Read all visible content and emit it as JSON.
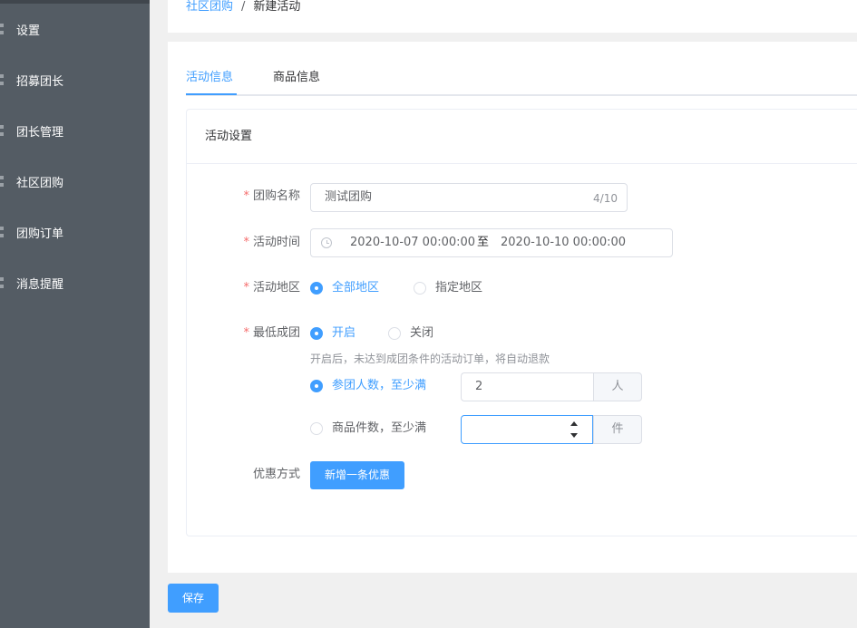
{
  "sidebar": {
    "items": [
      {
        "label": "设置"
      },
      {
        "label": "招募团长"
      },
      {
        "label": "团长管理"
      },
      {
        "label": "社区团购"
      },
      {
        "label": "团购订单"
      },
      {
        "label": "消息提醒"
      }
    ]
  },
  "breadcrumb": {
    "parent": "社区团购",
    "separator": "/",
    "current": "新建活动"
  },
  "tabs": [
    {
      "label": "活动信息",
      "active": true
    },
    {
      "label": "商品信息",
      "active": false
    }
  ],
  "card": {
    "title": "活动设置"
  },
  "form": {
    "name": {
      "label": "团购名称",
      "value": "测试团购",
      "count": "4/10"
    },
    "time": {
      "label": "活动时间",
      "start": "2020-10-07 00:00:00",
      "separator": "至",
      "end": "2020-10-10 00:00:00"
    },
    "region": {
      "label": "活动地区",
      "options": [
        "全部地区",
        "指定地区"
      ],
      "selected": "全部地区"
    },
    "min_group": {
      "label": "最低成团",
      "options": [
        "开启",
        "关闭"
      ],
      "selected": "开启",
      "hint": "开启后，未达到成团条件的活动订单，将自动退款",
      "rule_people": {
        "label": "参团人数，至少满",
        "value": "2",
        "unit": "人",
        "selected": true
      },
      "rule_items": {
        "label": "商品件数，至少满",
        "value": "",
        "unit": "件",
        "selected": false
      }
    },
    "discount": {
      "label": "优惠方式",
      "button": "新增一条优惠"
    }
  },
  "footer": {
    "save_label": "保存"
  },
  "colors": {
    "primary": "#409eff",
    "sidebar": "#545c64",
    "required": "#f56c6c"
  }
}
